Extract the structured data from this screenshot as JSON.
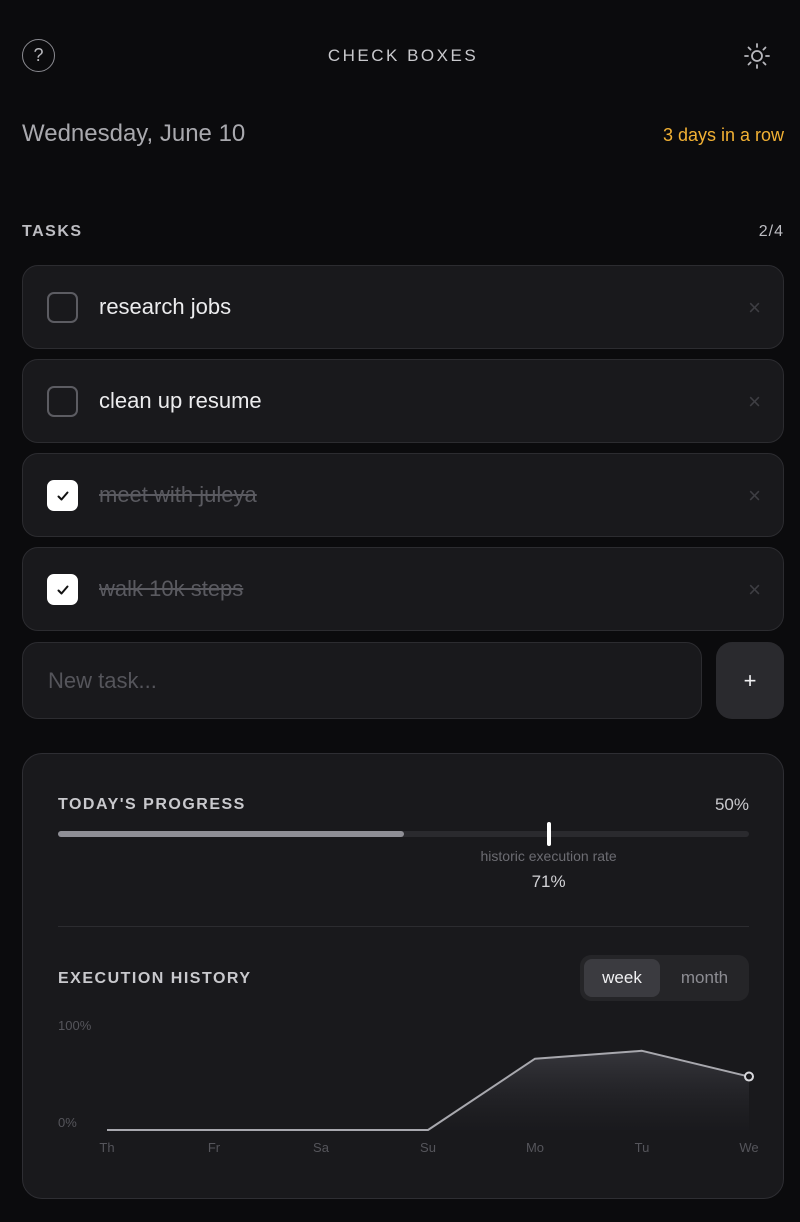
{
  "header": {
    "title": "CHECK BOXES",
    "help_glyph": "?",
    "help_icon": "help-circle-icon",
    "theme_icon": "sun-icon"
  },
  "date": "Wednesday, June 10",
  "streak": "3 days in a row",
  "tasks": {
    "label": "TASKS",
    "count": "2/4",
    "items": [
      {
        "label": "research jobs",
        "done": false
      },
      {
        "label": "clean up resume",
        "done": false
      },
      {
        "label": "meet with juleya",
        "done": true
      },
      {
        "label": "walk 10k steps",
        "done": true
      }
    ],
    "remove_glyph": "×",
    "check_glyph": "✓"
  },
  "new_task": {
    "placeholder": "New task...",
    "value": "",
    "add_label": "+"
  },
  "progress": {
    "label": "TODAY'S PROGRESS",
    "value_text": "50%",
    "fraction": 0.5,
    "historic_caption": "historic execution rate",
    "historic_text": "71%",
    "historic_fraction": 0.71
  },
  "history": {
    "label": "EXECUTION HISTORY",
    "toggle": {
      "week": "week",
      "month": "month",
      "selected": "week"
    }
  },
  "colors": {
    "accent": "#f2b134",
    "background": "#0b0b0d",
    "card": "#19191c"
  },
  "chart_data": {
    "type": "area",
    "categories": [
      "Th",
      "Fr",
      "Sa",
      "Su",
      "Mo",
      "Tu",
      "We"
    ],
    "values": [
      0,
      0,
      0,
      0,
      72,
      80,
      54
    ],
    "ylim": [
      0,
      100
    ],
    "ytick_labels": [
      "100%",
      "0%"
    ],
    "grid": false,
    "highlight_last": true
  }
}
